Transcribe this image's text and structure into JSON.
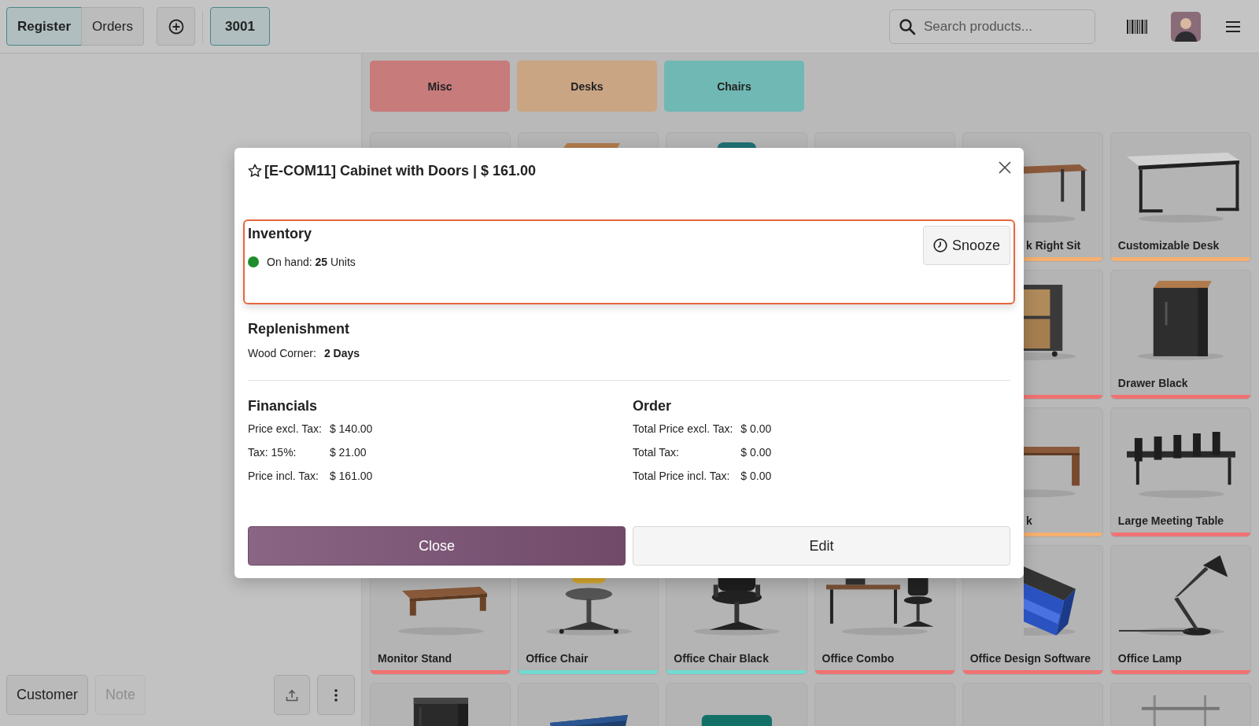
{
  "top_bar": {
    "tabs": [
      {
        "label": "Register",
        "selected": true
      },
      {
        "label": "Orders",
        "selected": false
      }
    ],
    "orders": [
      {
        "label": "3001",
        "selected": true
      }
    ],
    "search": {
      "placeholder": "Search products..."
    }
  },
  "order_panel": {
    "buttons": [
      {
        "label": "Customer",
        "disabled": false
      },
      {
        "label": "Note",
        "disabled": true
      }
    ]
  },
  "categories": [
    {
      "label": "Misc",
      "color": "#c87b7b"
    },
    {
      "label": "Desks",
      "color": "#c9a584"
    },
    {
      "label": "Chairs",
      "color": "#70b8b3"
    }
  ],
  "product_rows": [
    {
      "cards": [
        {
          "kind": "product"
        },
        {
          "kind": "product"
        },
        {
          "kind": "product"
        },
        {
          "kind": "product"
        },
        {
          "kind": "product",
          "name": "k Right Sit",
          "color": "#f5b070"
        },
        {
          "kind": "product",
          "name": "Customizable Desk",
          "color": "#f5b070"
        }
      ]
    },
    {
      "cards": [
        {
          "kind": "product",
          "color": "#f07272"
        },
        {
          "kind": "product",
          "name": "Drawer Black",
          "color": "#f07272"
        }
      ]
    },
    {
      "cards": [
        {
          "kind": "product",
          "name": "k",
          "color": "#f5b070"
        },
        {
          "kind": "product",
          "name": "Large Meeting Table",
          "color": "#f07272"
        }
      ]
    },
    {
      "cards": [
        {
          "kind": "product",
          "name": "Monitor Stand",
          "color": "#f07272"
        },
        {
          "kind": "product",
          "name": "Office Chair",
          "color": "#72dacf"
        },
        {
          "kind": "product",
          "name": "Office Chair Black",
          "color": "#72dacf"
        },
        {
          "kind": "product",
          "name": "Office Combo",
          "color": "#f07272"
        },
        {
          "kind": "product",
          "name": "Office Design Software",
          "color": "#f07272"
        },
        {
          "kind": "product",
          "name": "Office Lamp",
          "color": "#f07272"
        }
      ]
    },
    {
      "cards": [
        {
          "kind": "product"
        },
        {
          "kind": "product"
        },
        {
          "kind": "product"
        },
        {
          "kind": "product"
        },
        {
          "kind": "product"
        },
        {
          "kind": "product"
        }
      ]
    }
  ],
  "dialog": {
    "title": "[E-COM11] Cabinet with Doors | $ 161.00",
    "favorite": false,
    "inventory": {
      "heading": "Inventory",
      "snooze": "Snooze",
      "stock": "On hand: **25** Units"
    },
    "replenishment": {
      "heading": "Replenishment",
      "rows": [
        {
          "label": "Wood Corner:",
          "value": "2 Days"
        }
      ]
    },
    "financials": {
      "heading": "Financials",
      "rows": [
        {
          "label": "Price excl. Tax:",
          "value": "$ 140.00"
        },
        {
          "label": "Tax: 15%:",
          "value": "$ 21.00"
        },
        {
          "label": "Price incl. Tax:",
          "value": "$ 161.00"
        }
      ]
    },
    "order": {
      "heading": "Order",
      "rows": [
        {
          "label": "Total Price excl. Tax:",
          "value": "$ 0.00"
        },
        {
          "label": "Total Tax:",
          "value": "$ 0.00"
        },
        {
          "label": "Total Price incl. Tax:",
          "value": "$ 0.00"
        }
      ]
    },
    "buttons": [
      {
        "label": "Close",
        "kind": "primary"
      },
      {
        "label": "Edit",
        "kind": "secondary"
      }
    ]
  }
}
